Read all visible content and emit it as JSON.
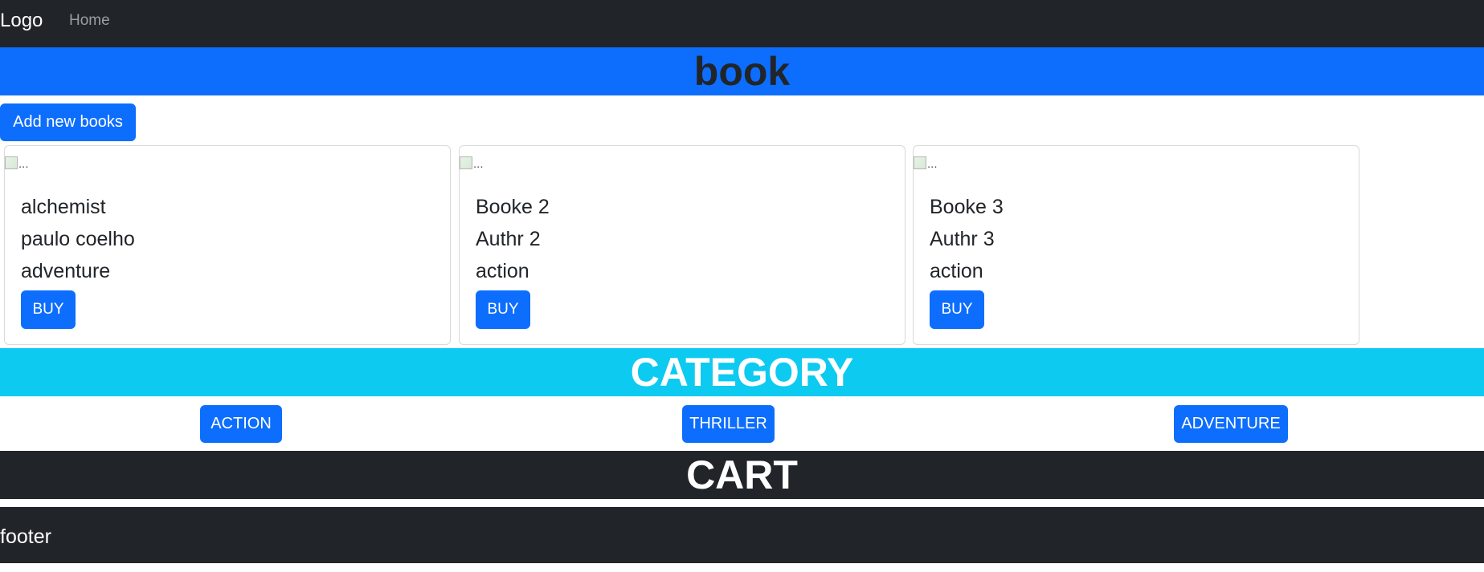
{
  "navbar": {
    "brand": "Logo",
    "links": [
      "Home"
    ]
  },
  "books_section": {
    "title": "book",
    "add_button": "Add new books",
    "cards": [
      {
        "image_alt": "...",
        "title": "alchemist",
        "author": "paulo coelho",
        "genre": "adventure",
        "buy_label": "BUY"
      },
      {
        "image_alt": "...",
        "title": "Booke 2",
        "author": "Authr 2",
        "genre": "action",
        "buy_label": "BUY"
      },
      {
        "image_alt": "...",
        "title": "Booke 3",
        "author": "Authr 3",
        "genre": "action",
        "buy_label": "BUY"
      }
    ]
  },
  "category_section": {
    "title": "CATEGORY",
    "buttons": [
      "ACTION",
      "THRILLER",
      "ADVENTURE"
    ]
  },
  "cart_section": {
    "title": "CART"
  },
  "footer": {
    "text": "footer"
  },
  "colors": {
    "navbar": "#212529",
    "primary": "#0d6efd",
    "info": "#0dcaf0",
    "text": "#212529"
  },
  "icons": {
    "broken_image": "broken-image-icon"
  }
}
